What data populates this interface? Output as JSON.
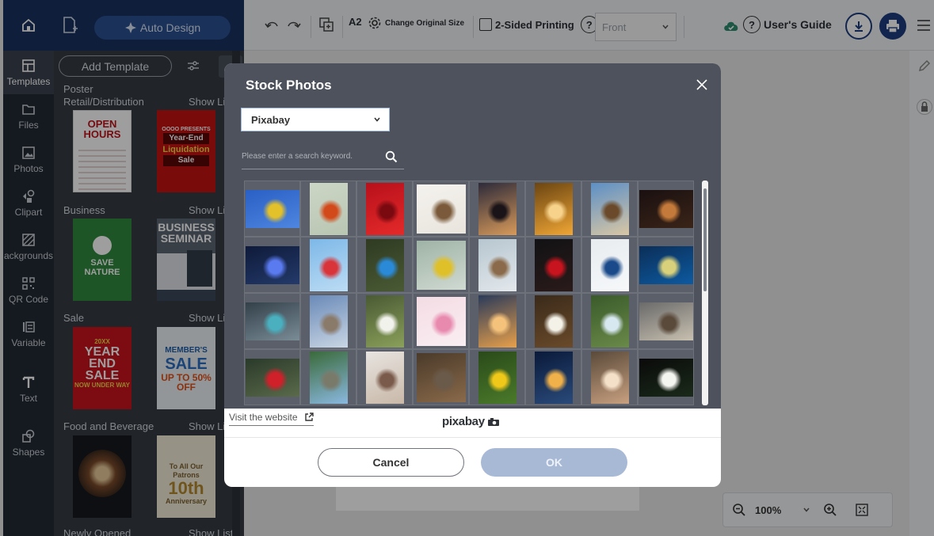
{
  "colors": {
    "brand_navy": "#19315f",
    "accent_blue": "#2a4f91",
    "sidebar_dark": "#232a34",
    "panel_dark": "#363c45",
    "modal_gray": "#4d525c",
    "ok_disabled": "#a8b9d6"
  },
  "header": {
    "auto_design_label": "Auto Design",
    "new_doc_icon": "new-document-icon"
  },
  "rail": {
    "items": [
      {
        "label": "Templates",
        "icon": "templates-icon"
      },
      {
        "label": "Files",
        "icon": "folder-icon"
      },
      {
        "label": "Photos",
        "icon": "photo-icon"
      },
      {
        "label": "Clipart",
        "icon": "clipart-icon"
      },
      {
        "label": "ackgrounds",
        "icon": "background-icon"
      },
      {
        "label": "QR Code",
        "icon": "qr-icon"
      },
      {
        "label": "Variable",
        "icon": "variable-icon"
      },
      {
        "label": "Text",
        "icon": "text-icon"
      },
      {
        "label": "Shapes",
        "icon": "shapes-icon"
      }
    ]
  },
  "panel": {
    "add_template": "Add Template",
    "poster_label": "Poster",
    "sections": [
      {
        "title": "Retail/Distribution",
        "show": "Show Lis"
      },
      {
        "title": "Business",
        "show": "Show Lis"
      },
      {
        "title": "Sale",
        "show": "Show Lis"
      },
      {
        "title": "Food and Beverage",
        "show": "Show Lis"
      },
      {
        "title": "Newly Opened",
        "show": "Show List"
      }
    ],
    "thumbs": {
      "open_hours": {
        "l1": "OPEN",
        "l2": "HOURS"
      },
      "year_end": {
        "l1": "OOOO PRESENTS",
        "l2": "Year-End",
        "l3": "Liquidation",
        "l4": "Sale"
      },
      "save_nature": {
        "l1": "SAVE",
        "l2": "NATURE"
      },
      "biz_seminar": {
        "l1": "BUSINESS",
        "l2": "SEMINAR"
      },
      "year_end_sale": {
        "l1": "20XX",
        "l2": "YEAR",
        "l3": "END",
        "l4": "SALE",
        "l5": "NOW UNDER WAY"
      },
      "member_sale": {
        "l1": "MEMBER'S",
        "l2": "SALE",
        "l3": "UP TO 50% OFF"
      },
      "anniv": {
        "l1": "To All Our Patrons",
        "l2": "10th",
        "l3": "Anniversary"
      }
    }
  },
  "toolbar": {
    "paper_size": "A2",
    "change_size": "Change Original Size",
    "two_sided": "2-Sided Printing",
    "side_select": "Front",
    "guide": "User's Guide"
  },
  "zoom": {
    "value": "100%"
  },
  "modal": {
    "title": "Stock Photos",
    "source": "Pixabay",
    "search_placeholder": "Please enter a search keyword.",
    "visit": "Visit the website",
    "logo": "pixabay",
    "cancel": "Cancel",
    "ok": "OK",
    "photos": [
      {
        "c1": "#2a5fc4",
        "c2": "#4e86e0",
        "s": "#e3c12a"
      },
      {
        "c1": "#ccd6c5",
        "c2": "#b9c6b2",
        "s": "#d24a1a"
      },
      {
        "c1": "#b8101b",
        "c2": "#e42a2a",
        "s": "#7a0a10"
      },
      {
        "c1": "#f4f2ee",
        "c2": "#e9e5dd",
        "s": "#7a5a3a"
      },
      {
        "c1": "#2d2a3a",
        "c2": "#d89a5a",
        "s": "#1a1418"
      },
      {
        "c1": "#6b4512",
        "c2": "#f0a635",
        "s": "#f7d28a"
      },
      {
        "c1": "#5c8fc6",
        "c2": "#d9c7a4",
        "s": "#6a4a2a"
      },
      {
        "c1": "#1a1010",
        "c2": "#3a2418",
        "s": "#c47a3a"
      },
      {
        "c1": "#0e1a3a",
        "c2": "#243a6a",
        "s": "#5a7af0"
      },
      {
        "c1": "#7db8e8",
        "c2": "#bcdcf4",
        "s": "#d8343a"
      },
      {
        "c1": "#2f3a22",
        "c2": "#4a5a34",
        "s": "#2a8ad8"
      },
      {
        "c1": "#9fb3a6",
        "c2": "#d0dad2",
        "s": "#e0c028"
      },
      {
        "c1": "#b7c6cf",
        "c2": "#e3e8ec",
        "s": "#8a6a4a"
      },
      {
        "c1": "#121214",
        "c2": "#2a1a1a",
        "s": "#c8141e"
      },
      {
        "c1": "#e8ecef",
        "c2": "#f6f8fa",
        "s": "#1a4a8a"
      },
      {
        "c1": "#0b2e58",
        "c2": "#0d5aa0",
        "s": "#d8d07a"
      },
      {
        "c1": "#33404a",
        "c2": "#7a8c96",
        "s": "#4ab0c0"
      },
      {
        "c1": "#6a8ab8",
        "c2": "#c9d6e4",
        "s": "#8a7a6a"
      },
      {
        "c1": "#4a5a34",
        "c2": "#8aa05a",
        "s": "#f2f2ec"
      },
      {
        "c1": "#f4dce4",
        "c2": "#f9eef2",
        "s": "#e889ae"
      },
      {
        "c1": "#2a3a5a",
        "c2": "#e8a04a",
        "s": "#f4c27a"
      },
      {
        "c1": "#3a2a1a",
        "c2": "#6a4a2a",
        "s": "#f4f2e8"
      },
      {
        "c1": "#3a5a2a",
        "c2": "#6a8a4a",
        "s": "#d8e8f0"
      },
      {
        "c1": "#6a6a6a",
        "c2": "#c8c0b0",
        "s": "#5a4a3a"
      },
      {
        "c1": "#2a3a2a",
        "c2": "#5a6a4a",
        "s": "#d0202a"
      },
      {
        "c1": "#3a6a3a",
        "c2": "#8ab8e0",
        "s": "#7a7a6a"
      },
      {
        "c1": "#e8e4e0",
        "c2": "#c8b8a8",
        "s": "#7a5a4a"
      },
      {
        "c1": "#4a3a2a",
        "c2": "#8a6a4a",
        "s": "#6a5a4a"
      },
      {
        "c1": "#2a4a1a",
        "c2": "#4a7a2a",
        "s": "#f0c81a"
      },
      {
        "c1": "#0a1a3a",
        "c2": "#2a4a7a",
        "s": "#f0b04a"
      },
      {
        "c1": "#5a4a3a",
        "c2": "#c8a080",
        "s": "#f4e0c8"
      },
      {
        "c1": "#0a0a0a",
        "c2": "#1a2a1a",
        "s": "#f4f4f0"
      }
    ]
  }
}
